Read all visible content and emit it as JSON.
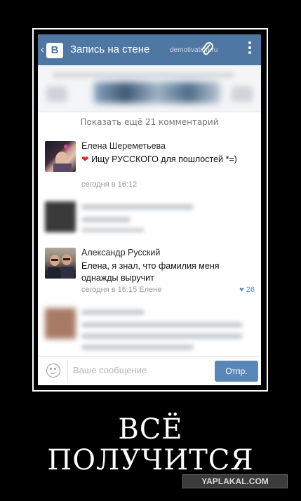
{
  "app": {
    "title": "Запись на стене",
    "header_watermark": "demotivation.ru",
    "icons": [
      "back-chevron-icon",
      "vk-logo-icon",
      "paperclip-icon",
      "more-vertical-icon"
    ],
    "accent": "#4f77a3"
  },
  "show_more_label": "Показать ещё 21 комментарий",
  "comments": [
    {
      "name": "Елена Шереметьева",
      "text": "Ищу РУССКОГО для пошлостей *=)",
      "time": "сегодня в 16:12"
    },
    {
      "name": "Александр Русский",
      "text": "Елена, я знал, что фамилия меня однажды выручит",
      "time": "сегодня в 16:15 Елене",
      "likes": "26"
    }
  ],
  "input": {
    "placeholder": "Ваше сообщение",
    "send_label": "Отпр."
  },
  "caption": {
    "line1": "ВСЁ",
    "line2": "ПОЛУЧИТСЯ"
  },
  "site_watermark": "YAPLAKAL.COM"
}
